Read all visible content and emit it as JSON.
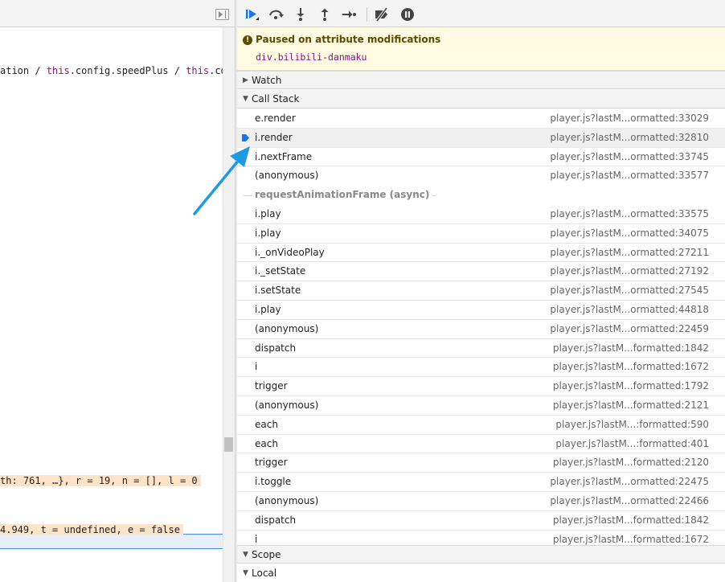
{
  "code": {
    "line1": {
      "prefix": "ation / ",
      "kw1": "this",
      "middle": ".config.speedPlus / ",
      "kw2": "this",
      "suffix": ".co"
    },
    "line2": "th: 761, …}, r = 19, n = [], l = 0",
    "line3": " 4.949, t = undefined, e = false"
  },
  "toolbar": {
    "buttons": [
      {
        "name": "resume-button",
        "icon": "resume-icon",
        "color": "#1a73e8"
      },
      {
        "name": "step-over-button",
        "icon": "step-over-icon"
      },
      {
        "name": "step-into-button",
        "icon": "step-into-icon"
      },
      {
        "name": "step-out-button",
        "icon": "step-out-icon"
      },
      {
        "name": "step-button",
        "icon": "step-icon"
      },
      {
        "name": "deactivate-breakpoints-button",
        "icon": "breakpoint-slash-icon"
      },
      {
        "name": "pause-on-exceptions-button",
        "icon": "pause-circle-icon"
      }
    ]
  },
  "pause": {
    "title": "Paused on attribute modifications",
    "target": "div.bilibili-danmaku"
  },
  "sections": {
    "watch": "Watch",
    "call_stack": "Call Stack",
    "scope": "Scope",
    "local": "Local"
  },
  "async_label": "requestAnimationFrame (async)",
  "frames_before": [
    {
      "name": "e.render",
      "location": "player.js?lastM...ormatted:33029",
      "selected": false
    },
    {
      "name": "i.render",
      "location": "player.js?lastM...ormatted:32810",
      "selected": true
    },
    {
      "name": "i.nextFrame",
      "location": "player.js?lastM...ormatted:33745",
      "selected": false
    },
    {
      "name": "(anonymous)",
      "location": "player.js?lastM...ormatted:33577",
      "selected": false
    }
  ],
  "frames_after": [
    {
      "name": "i.play",
      "location": "player.js?lastM...ormatted:33575"
    },
    {
      "name": "i.play",
      "location": "player.js?lastM...ormatted:34075"
    },
    {
      "name": "i._onVideoPlay",
      "location": "player.js?lastM...ormatted:27211"
    },
    {
      "name": "i._setState",
      "location": "player.js?lastM...ormatted:27192"
    },
    {
      "name": "i.setState",
      "location": "player.js?lastM...ormatted:27545"
    },
    {
      "name": "i.play",
      "location": "player.js?lastM...ormatted:44818"
    },
    {
      "name": "(anonymous)",
      "location": "player.js?lastM...ormatted:22459"
    },
    {
      "name": "dispatch",
      "location": "player.js?lastM...formatted:1842"
    },
    {
      "name": "i",
      "location": "player.js?lastM...formatted:1672"
    },
    {
      "name": "trigger",
      "location": "player.js?lastM...formatted:1792"
    },
    {
      "name": "(anonymous)",
      "location": "player.js?lastM...formatted:2121"
    },
    {
      "name": "each",
      "location": "player.js?lastM...:formatted:590"
    },
    {
      "name": "each",
      "location": "player.js?lastM...:formatted:401"
    },
    {
      "name": "trigger",
      "location": "player.js?lastM...formatted:2120"
    },
    {
      "name": "i.toggle",
      "location": "player.js?lastM...ormatted:22475"
    },
    {
      "name": "(anonymous)",
      "location": "player.js?lastM...ormatted:22466"
    },
    {
      "name": "dispatch",
      "location": "player.js?lastM...formatted:1842"
    },
    {
      "name": "i",
      "location": "player.js?lastM...formatted:1672"
    }
  ],
  "colors": {
    "accent": "#1a73e8",
    "annotation_arrow": "#1e9be0",
    "pause_banner": "#fffbe2"
  }
}
